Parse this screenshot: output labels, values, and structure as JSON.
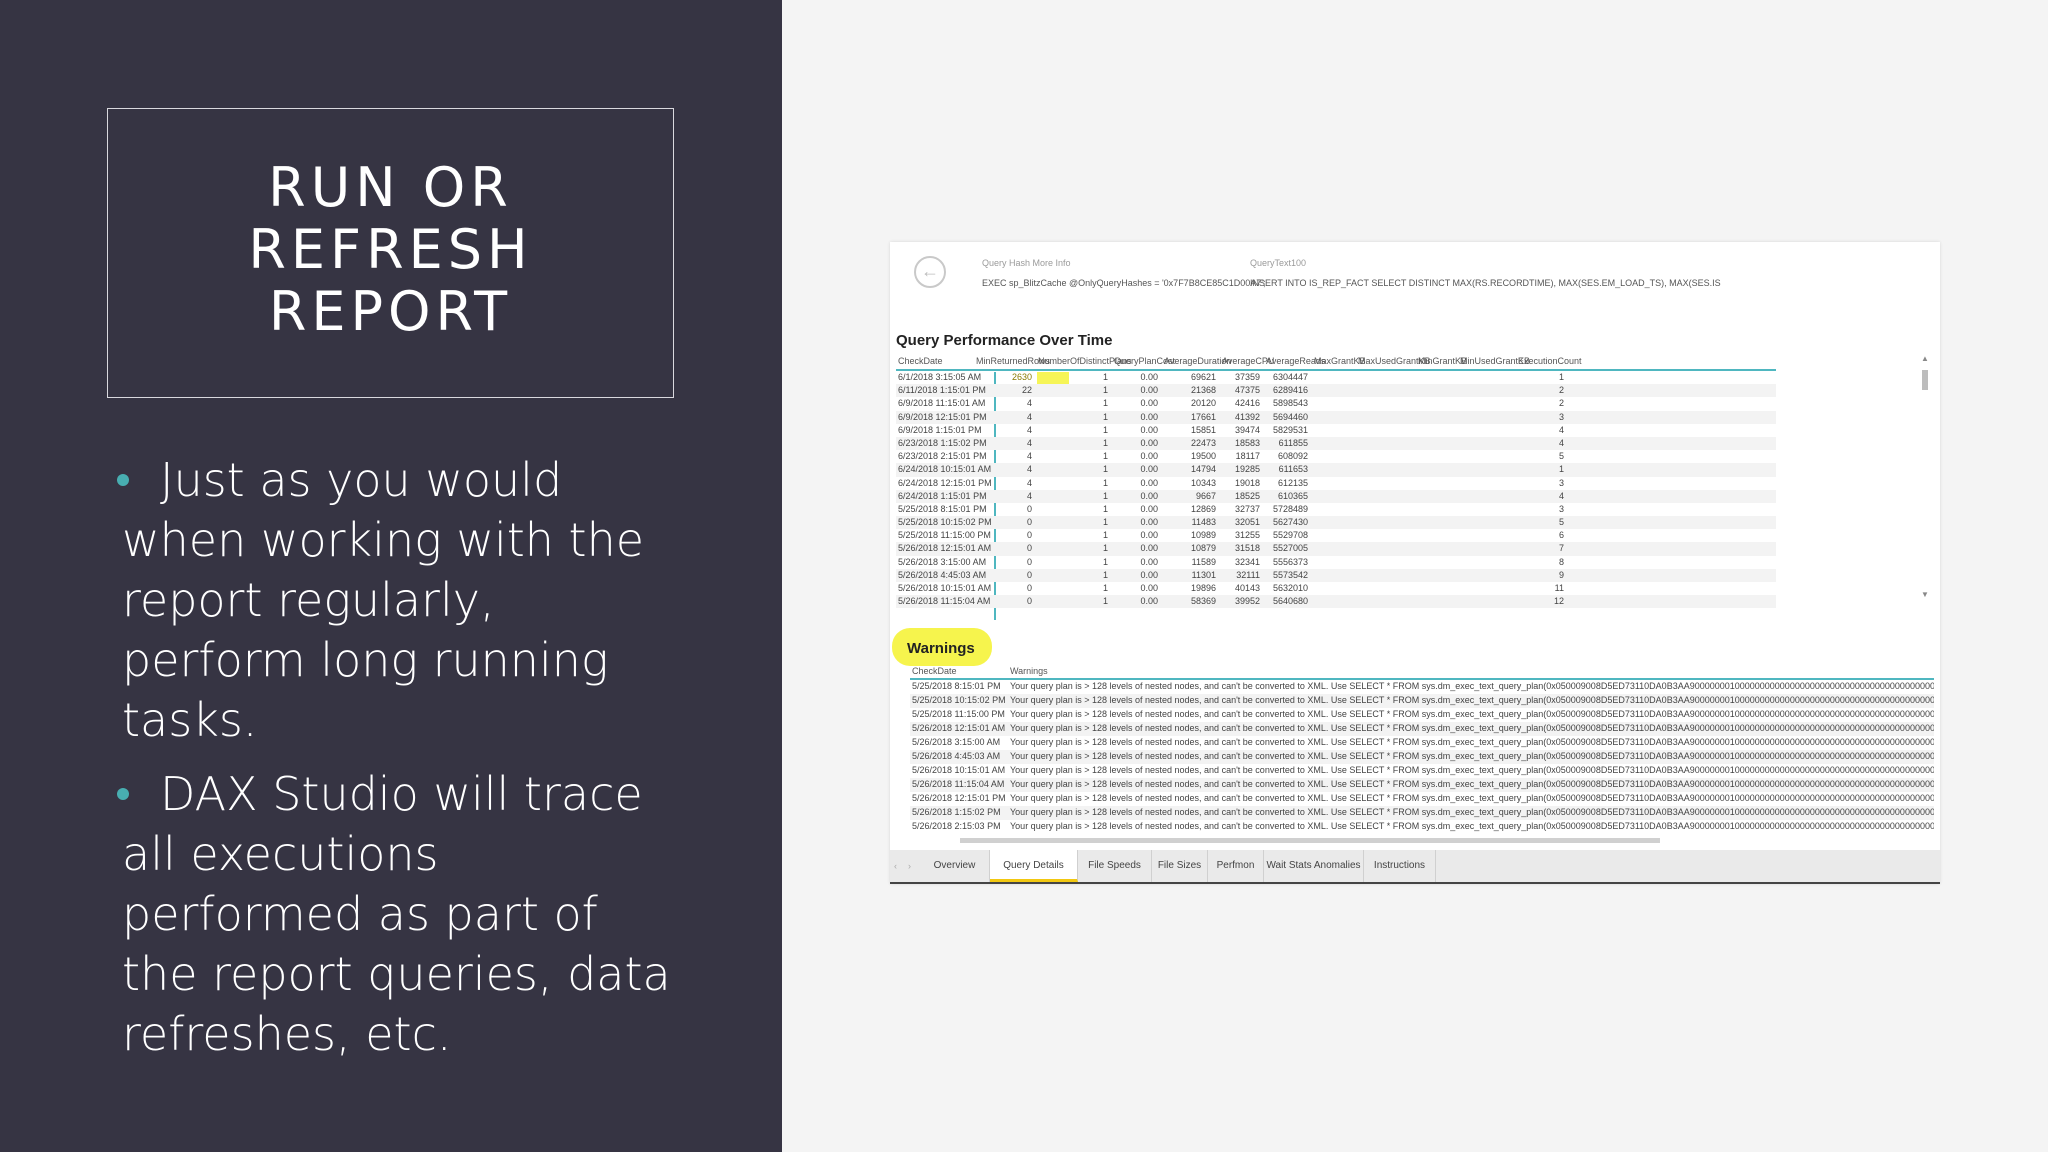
{
  "slide": {
    "title_lines": [
      "RUN OR",
      "REFRESH",
      "REPORT"
    ],
    "bullets": [
      "Just as you would when working with the report regularly, perform long running tasks.",
      "DAX Studio will trace all executions performed as part of the report queries, data refreshes, etc."
    ]
  },
  "report": {
    "info": {
      "label1": "Query Hash More Info",
      "value1": "EXEC sp_BlitzCache @OnlyQueryHashes = '0x7F7B8CE85C1D00A7';",
      "label2": "QueryText100",
      "value2": "INSERT INTO IS_REP_FACT   SELECT DISTINCT MAX(RS.RECORDTIME),   MAX(SES.EM_LOAD_TS),   MAX(SES.IS"
    },
    "perf": {
      "title": "Query Performance Over Time",
      "columns": [
        "CheckDate",
        "MinReturnedRows",
        "NumberOfDistinctPlans",
        "QueryPlanCost",
        "AverageDuration",
        "AverageCPU",
        "AverageReads",
        "MaxGrantKB",
        "MaxUsedGrantKB",
        "MinGrantKB",
        "MinUsedGrantKB",
        "ExecutionCount"
      ],
      "rows": [
        [
          "6/1/2018 3:15:05 AM",
          "2630",
          "1",
          "0.00",
          "69621",
          "37359",
          "6304447",
          "1"
        ],
        [
          "6/11/2018 1:15:01 PM",
          "22",
          "1",
          "0.00",
          "21368",
          "47375",
          "6289416",
          "2"
        ],
        [
          "6/9/2018 11:15:01 AM",
          "4",
          "1",
          "0.00",
          "20120",
          "42416",
          "5898543",
          "2"
        ],
        [
          "6/9/2018 12:15:01 PM",
          "4",
          "1",
          "0.00",
          "17661",
          "41392",
          "5694460",
          "3"
        ],
        [
          "6/9/2018 1:15:01 PM",
          "4",
          "1",
          "0.00",
          "15851",
          "39474",
          "5829531",
          "4"
        ],
        [
          "6/23/2018 1:15:02 PM",
          "4",
          "1",
          "0.00",
          "22473",
          "18583",
          "611855",
          "4"
        ],
        [
          "6/23/2018 2:15:01 PM",
          "4",
          "1",
          "0.00",
          "19500",
          "18117",
          "608092",
          "5"
        ],
        [
          "6/24/2018 10:15:01 AM",
          "4",
          "1",
          "0.00",
          "14794",
          "19285",
          "611653",
          "1"
        ],
        [
          "6/24/2018 12:15:01 PM",
          "4",
          "1",
          "0.00",
          "10343",
          "19018",
          "612135",
          "3"
        ],
        [
          "6/24/2018 1:15:01 PM",
          "4",
          "1",
          "0.00",
          "9667",
          "18525",
          "610365",
          "4"
        ],
        [
          "5/25/2018 8:15:01 PM",
          "0",
          "1",
          "0.00",
          "12869",
          "32737",
          "5728489",
          "3"
        ],
        [
          "5/25/2018 10:15:02 PM",
          "0",
          "1",
          "0.00",
          "11483",
          "32051",
          "5627430",
          "5"
        ],
        [
          "5/25/2018 11:15:00 PM",
          "0",
          "1",
          "0.00",
          "10989",
          "31255",
          "5529708",
          "6"
        ],
        [
          "5/26/2018 12:15:01 AM",
          "0",
          "1",
          "0.00",
          "10879",
          "31518",
          "5527005",
          "7"
        ],
        [
          "5/26/2018 3:15:00 AM",
          "0",
          "1",
          "0.00",
          "11589",
          "32341",
          "5556373",
          "8"
        ],
        [
          "5/26/2018 4:45:03 AM",
          "0",
          "1",
          "0.00",
          "11301",
          "32111",
          "5573542",
          "9"
        ],
        [
          "5/26/2018 10:15:01 AM",
          "0",
          "1",
          "0.00",
          "19896",
          "40143",
          "5632010",
          "11"
        ],
        [
          "5/26/2018 11:15:04 AM",
          "0",
          "1",
          "0.00",
          "58369",
          "39952",
          "5640680",
          "12"
        ]
      ]
    },
    "warnings": {
      "title": "Warnings",
      "columns": [
        "CheckDate",
        "Warnings"
      ],
      "text": "Your query plan is > 128 levels of nested nodes, and can't be converted to XML. Use SELECT * FROM sys.dm_exec_text_query_plan(0x050009008D5ED73110DA0B3AA9000000010000000000000000000000000000000000000000000000000000000000000000000000",
      "rows": [
        "5/25/2018 8:15:01 PM",
        "5/25/2018 10:15:02 PM",
        "5/25/2018 11:15:00 PM",
        "5/26/2018 12:15:01 AM",
        "5/26/2018 3:15:00 AM",
        "5/26/2018 4:45:03 AM",
        "5/26/2018 10:15:01 AM",
        "5/26/2018 11:15:04 AM",
        "5/26/2018 12:15:01 PM",
        "5/26/2018 1:15:02 PM",
        "5/26/2018 2:15:03 PM"
      ]
    },
    "tabs": [
      "Overview",
      "Query Details",
      "File Speeds",
      "File Sizes",
      "Perfmon",
      "Wait Stats Anomalies",
      "Instructions"
    ],
    "active_tab": "Query Details",
    "highlight_color": "#f5f33a",
    "accent_color": "#4fb7c0"
  }
}
